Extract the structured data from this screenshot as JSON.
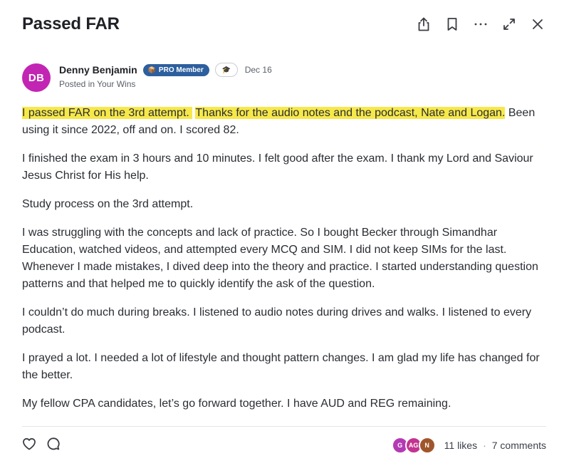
{
  "post": {
    "title": "Passed FAR",
    "author": {
      "initials": "DB",
      "name": "Denny Benjamin",
      "badge": "PRO Member",
      "badge_icon": "📦",
      "cap_icon": "🎓",
      "date": "Dec 16",
      "posted_in": "Posted in Your Wins",
      "avatar_color": "#c225b3"
    },
    "paragraphs": {
      "p1_hl1": "I passed FAR on the 3rd attempt.",
      "p1_hl2": "Thanks for the audio notes and the podcast, Nate and Logan.",
      "p1_rest": "Been using it since 2022, off and on.  I scored 82.",
      "p2": "I finished the exam in 3 hours and 10 minutes.  I felt good after the exam.  I thank my Lord and Saviour Jesus Christ for His help.",
      "p3": "Study process on the 3rd attempt.",
      "p4": "I was struggling with the concepts and lack of practice.  So I bought Becker through Simandhar Education, watched videos, and attempted every MCQ and SIM.  I did not keep SIMs for the last.  Whenever I made mistakes, I dived deep into the theory and practice.  I started understanding question patterns and that helped me to quickly identify the ask of the question.",
      "p5": "I couldn’t do much during breaks.  I listened to audio notes during drives and walks.  I listened to every podcast.",
      "p6": "I prayed a lot.  I needed a lot of lifestyle and thought pattern changes.  I am glad my life has changed for the better.",
      "p7": "My fellow CPA candidates, let’s go forward together.  I have AUD and REG remaining."
    },
    "likers": [
      {
        "initials": "G",
        "color": "#b43ab4"
      },
      {
        "initials": "AG",
        "color": "#c3338f"
      },
      {
        "initials": "N",
        "color": "#a0562b"
      }
    ],
    "likes_text": "11 likes",
    "separator": "·",
    "comments_text": "7 comments",
    "highlight_color": "#f7e84a"
  }
}
